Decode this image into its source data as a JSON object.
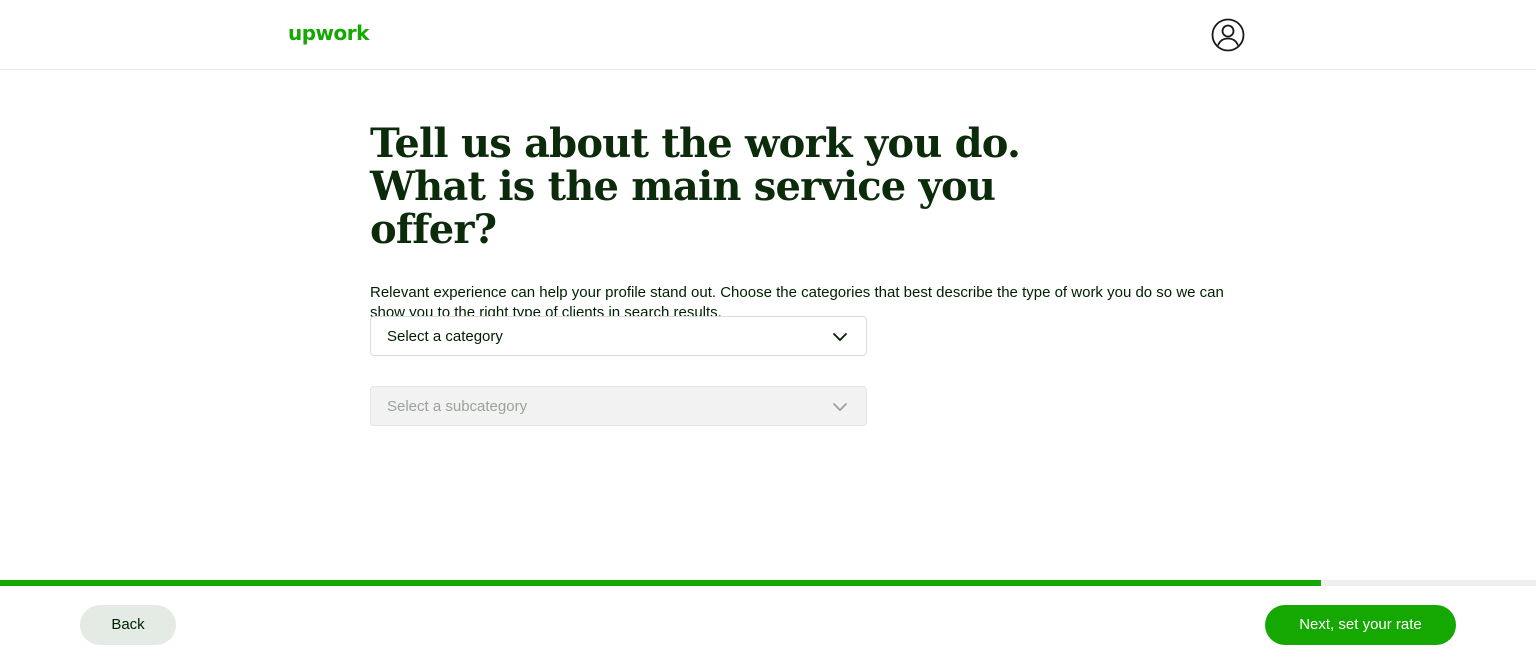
{
  "header": {
    "logo_text": "upwork",
    "brand_color": "#14a800",
    "avatar_icon": "user-circle-icon"
  },
  "main": {
    "title": "Tell us about the work you do. What is the main service you offer?",
    "description": "Relevant experience can help your profile stand out. Choose the categories that best describe the type of work you do so we can show you to the right type of clients in search results.",
    "category_select": {
      "placeholder": "Select a category",
      "icon": "chevron-down-icon",
      "enabled": true
    },
    "subcategory_select": {
      "placeholder": "Select a subcategory",
      "icon": "chevron-down-icon",
      "enabled": false
    }
  },
  "progress": {
    "value_percent": 86,
    "fill_color": "#14a800"
  },
  "footer": {
    "back_label": "Back",
    "next_label": "Next, set your rate"
  }
}
